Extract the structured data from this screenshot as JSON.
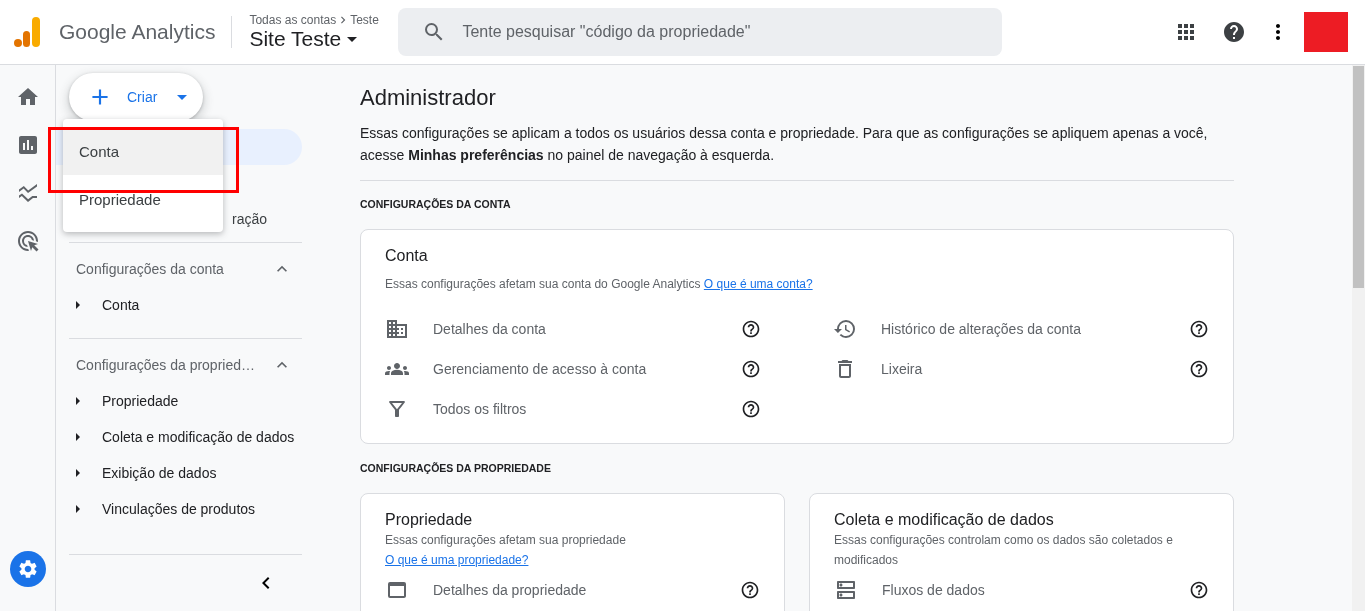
{
  "header": {
    "product": "Google Analytics",
    "breadcrumb_parent": "Todas as contas",
    "breadcrumb_child": "Teste",
    "property": "Site Teste",
    "search": {
      "placeholder": "Tente pesquisar \"código da propriedade\""
    }
  },
  "rail": [
    {
      "kind": "home",
      "selected": false
    },
    {
      "kind": "reports",
      "selected": false
    },
    {
      "kind": "explore",
      "selected": false
    },
    {
      "kind": "advertising",
      "selected": false
    },
    {
      "kind": "admin",
      "selected": true
    }
  ],
  "create_button": {
    "label": "Criar"
  },
  "create_menu": [
    {
      "label": "Conta",
      "hovered": true,
      "annotated": true
    },
    {
      "label": "Propriedade",
      "hovered": false,
      "annotated": false
    }
  ],
  "nav": {
    "top_items": [
      {
        "selected": true
      },
      {
        "label": "ração",
        "selected": false
      }
    ],
    "sections": [
      {
        "title": "Configurações da conta",
        "expanded": true,
        "items": [
          "Conta"
        ]
      },
      {
        "title": "Configurações da propried…",
        "expanded": true,
        "items": [
          "Propriedade",
          "Coleta e modificação de dados",
          "Exibição de dados",
          "Vinculações de produtos"
        ]
      }
    ]
  },
  "page": {
    "title": "Administrador",
    "intro": "Essas configurações se aplicam a todos os usuários dessa conta e propriedade. Para que as configurações se apliquem apenas a você, acesse **Minhas preferências** no painel de navegação à esquerda.",
    "account_heading": "CONFIGURAÇÕES DA CONTA",
    "account_card": {
      "title": "Conta",
      "description": "Essas configurações afetam sua conta do Google Analytics",
      "link": "O que é uma conta?",
      "rows": [
        {
          "kind": "building",
          "label": "Detalhes da conta"
        },
        {
          "kind": "history",
          "label": "Histórico de alterações da conta"
        },
        {
          "kind": "people",
          "label": "Gerenciamento de acesso à conta"
        },
        {
          "kind": "trash",
          "label": "Lixeira"
        },
        {
          "kind": "filter",
          "label": "Todos os filtros"
        }
      ]
    },
    "property_heading": "CONFIGURAÇÕES DA PROPRIEDADE",
    "property_cards": [
      {
        "title": "Propriedade",
        "description": "Essas configurações afetam sua propriedade",
        "link": "O que é uma propriedade?",
        "rows": [
          {
            "kind": "window",
            "label": "Detalhes da propriedade"
          }
        ]
      },
      {
        "title": "Coleta e modificação de dados",
        "description": "Essas configurações controlam como os dados são coletados e modificados",
        "rows": [
          {
            "kind": "streams",
            "label": "Fluxos de dados"
          }
        ]
      }
    ]
  }
}
